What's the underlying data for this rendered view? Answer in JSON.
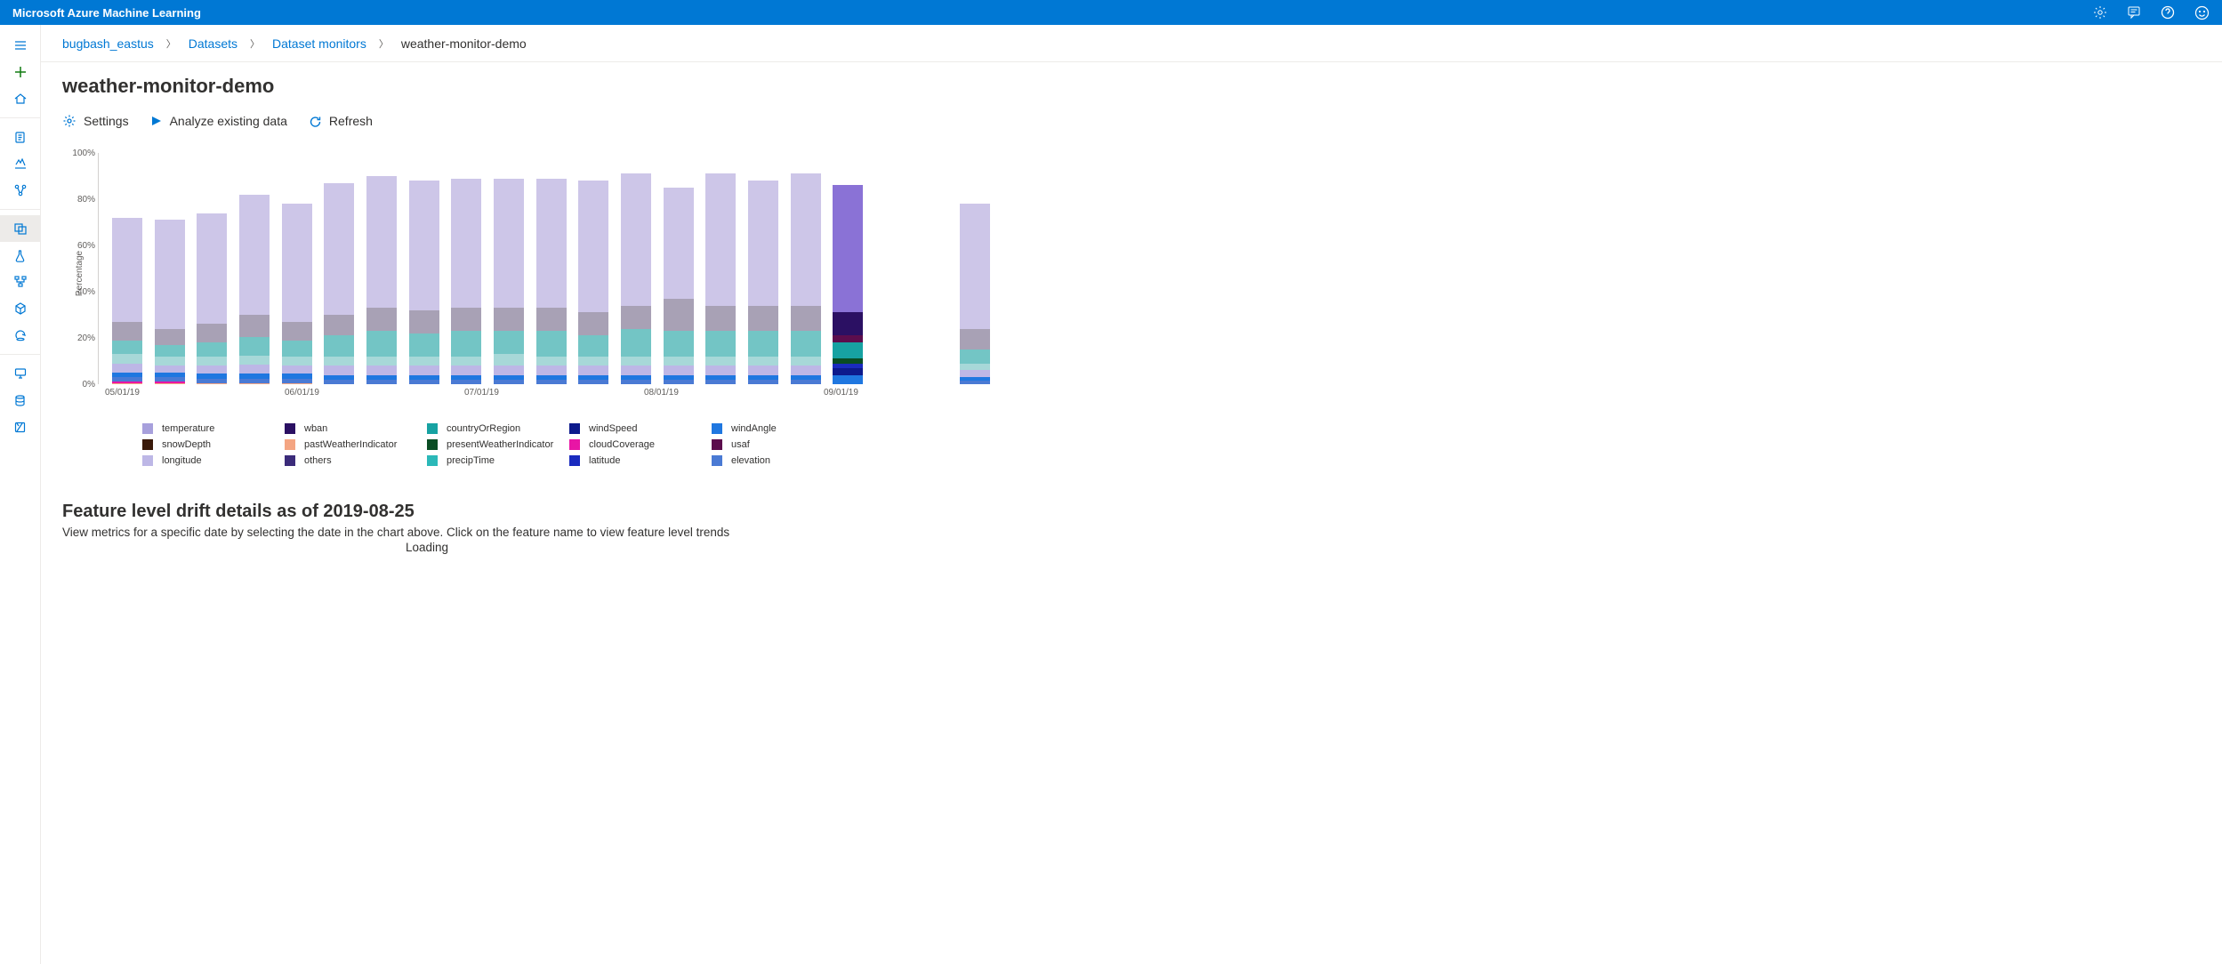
{
  "app_title": "Microsoft Azure Machine Learning",
  "breadcrumb": {
    "items": [
      "bugbash_eastus",
      "Datasets",
      "Dataset monitors"
    ],
    "current": "weather-monitor-demo"
  },
  "page_title": "weather-monitor-demo",
  "toolbar": {
    "settings": "Settings",
    "analyze": "Analyze existing data",
    "refresh": "Refresh"
  },
  "section": {
    "heading": "Feature level drift details as of 2019-08-25",
    "sub": "View metrics for a specific date by selecting the date in the chart above. Click on the feature name to view feature level trends",
    "loading": "Loading"
  },
  "chart_data": {
    "type": "bar",
    "ylabel": "Percentage",
    "ylim": [
      0,
      100
    ],
    "yticks": [
      0,
      20,
      40,
      60,
      80,
      100
    ],
    "xtick_labels": [
      {
        "x": 0,
        "label": "05/01/19"
      },
      {
        "x": 4,
        "label": "06/01/19"
      },
      {
        "x": 8,
        "label": "07/01/19"
      },
      {
        "x": 12,
        "label": "08/01/19"
      },
      {
        "x": 16,
        "label": "09/01/19"
      }
    ],
    "series": [
      {
        "name": "temperature",
        "color": "#a7a0dc"
      },
      {
        "name": "wban",
        "color": "#2b1063"
      },
      {
        "name": "countryOrRegion",
        "color": "#17a2a2"
      },
      {
        "name": "windSpeed",
        "color": "#0d1a8c"
      },
      {
        "name": "windAngle",
        "color": "#1f77e0"
      },
      {
        "name": "snowDepth",
        "color": "#3a1a0a"
      },
      {
        "name": "pastWeatherIndicator",
        "color": "#f4a582"
      },
      {
        "name": "presentWeatherIndicator",
        "color": "#0a4d24"
      },
      {
        "name": "cloudCoverage",
        "color": "#e815a5"
      },
      {
        "name": "usaf",
        "color": "#5c0d4d"
      },
      {
        "name": "longitude",
        "color": "#bdb7e6"
      },
      {
        "name": "others",
        "color": "#3b2b7a"
      },
      {
        "name": "precipTime",
        "color": "#2bb8b8"
      },
      {
        "name": "latitude",
        "color": "#1a2bbf"
      },
      {
        "name": "elevation",
        "color": "#4a7ad4"
      }
    ],
    "bars": [
      {
        "total": 72,
        "segs": [
          {
            "c": "#f4a582",
            "v": 0.5
          },
          {
            "c": "#e815a5",
            "v": 0.5
          },
          {
            "c": "#4a7ad4",
            "v": 2
          },
          {
            "c": "#1f77e0",
            "v": 2
          },
          {
            "c": "#bdb7e6",
            "v": 4
          },
          {
            "c": "#a7d8d8",
            "v": 4
          },
          {
            "c": "#73c5c5",
            "v": 6
          },
          {
            "c": "#a8a1b5",
            "v": 8
          },
          {
            "c": "#cdc6e8",
            "v": 45
          }
        ]
      },
      {
        "total": 71,
        "segs": [
          {
            "c": "#f4a582",
            "v": 0.5
          },
          {
            "c": "#e815a5",
            "v": 0.5
          },
          {
            "c": "#4a7ad4",
            "v": 2
          },
          {
            "c": "#1f77e0",
            "v": 2
          },
          {
            "c": "#bdb7e6",
            "v": 3
          },
          {
            "c": "#a7d8d8",
            "v": 4
          },
          {
            "c": "#73c5c5",
            "v": 5
          },
          {
            "c": "#a8a1b5",
            "v": 7
          },
          {
            "c": "#cdc6e8",
            "v": 47
          }
        ]
      },
      {
        "total": 74,
        "segs": [
          {
            "c": "#f4a582",
            "v": 0.5
          },
          {
            "c": "#4a7ad4",
            "v": 2
          },
          {
            "c": "#1f77e0",
            "v": 2
          },
          {
            "c": "#bdb7e6",
            "v": 3.5
          },
          {
            "c": "#a7d8d8",
            "v": 4
          },
          {
            "c": "#73c5c5",
            "v": 6
          },
          {
            "c": "#a8a1b5",
            "v": 8
          },
          {
            "c": "#cdc6e8",
            "v": 48
          }
        ]
      },
      {
        "total": 82,
        "segs": [
          {
            "c": "#f4a582",
            "v": 0.5
          },
          {
            "c": "#4a7ad4",
            "v": 2
          },
          {
            "c": "#1f77e0",
            "v": 2
          },
          {
            "c": "#bdb7e6",
            "v": 4
          },
          {
            "c": "#a7d8d8",
            "v": 4
          },
          {
            "c": "#73c5c5",
            "v": 8
          },
          {
            "c": "#a8a1b5",
            "v": 9.5
          },
          {
            "c": "#cdc6e8",
            "v": 52
          }
        ]
      },
      {
        "total": 78,
        "segs": [
          {
            "c": "#f4a582",
            "v": 0.5
          },
          {
            "c": "#4a7ad4",
            "v": 2
          },
          {
            "c": "#1f77e0",
            "v": 2
          },
          {
            "c": "#bdb7e6",
            "v": 3.5
          },
          {
            "c": "#a7d8d8",
            "v": 4
          },
          {
            "c": "#73c5c5",
            "v": 7
          },
          {
            "c": "#a8a1b5",
            "v": 8
          },
          {
            "c": "#cdc6e8",
            "v": 51
          }
        ]
      },
      {
        "total": 87,
        "segs": [
          {
            "c": "#4a7ad4",
            "v": 2
          },
          {
            "c": "#1f77e0",
            "v": 2
          },
          {
            "c": "#bdb7e6",
            "v": 4
          },
          {
            "c": "#a7d8d8",
            "v": 4
          },
          {
            "c": "#73c5c5",
            "v": 9
          },
          {
            "c": "#a8a1b5",
            "v": 9
          },
          {
            "c": "#cdc6e8",
            "v": 57
          }
        ]
      },
      {
        "total": 90,
        "segs": [
          {
            "c": "#4a7ad4",
            "v": 2
          },
          {
            "c": "#1f77e0",
            "v": 2
          },
          {
            "c": "#bdb7e6",
            "v": 4
          },
          {
            "c": "#a7d8d8",
            "v": 4
          },
          {
            "c": "#73c5c5",
            "v": 11
          },
          {
            "c": "#a8a1b5",
            "v": 10
          },
          {
            "c": "#cdc6e8",
            "v": 57
          }
        ]
      },
      {
        "total": 88,
        "segs": [
          {
            "c": "#4a7ad4",
            "v": 2
          },
          {
            "c": "#1f77e0",
            "v": 2
          },
          {
            "c": "#bdb7e6",
            "v": 4
          },
          {
            "c": "#a7d8d8",
            "v": 4
          },
          {
            "c": "#73c5c5",
            "v": 10
          },
          {
            "c": "#a8a1b5",
            "v": 10
          },
          {
            "c": "#cdc6e8",
            "v": 56
          }
        ]
      },
      {
        "total": 89,
        "segs": [
          {
            "c": "#4a7ad4",
            "v": 2
          },
          {
            "c": "#1f77e0",
            "v": 2
          },
          {
            "c": "#bdb7e6",
            "v": 4
          },
          {
            "c": "#a7d8d8",
            "v": 4
          },
          {
            "c": "#73c5c5",
            "v": 11
          },
          {
            "c": "#a8a1b5",
            "v": 10
          },
          {
            "c": "#cdc6e8",
            "v": 56
          }
        ]
      },
      {
        "total": 89,
        "segs": [
          {
            "c": "#4a7ad4",
            "v": 2
          },
          {
            "c": "#1f77e0",
            "v": 2
          },
          {
            "c": "#bdb7e6",
            "v": 4
          },
          {
            "c": "#a7d8d8",
            "v": 5
          },
          {
            "c": "#73c5c5",
            "v": 10
          },
          {
            "c": "#a8a1b5",
            "v": 10
          },
          {
            "c": "#cdc6e8",
            "v": 56
          }
        ]
      },
      {
        "total": 89,
        "segs": [
          {
            "c": "#4a7ad4",
            "v": 2
          },
          {
            "c": "#1f77e0",
            "v": 2
          },
          {
            "c": "#bdb7e6",
            "v": 4
          },
          {
            "c": "#a7d8d8",
            "v": 4
          },
          {
            "c": "#73c5c5",
            "v": 11
          },
          {
            "c": "#a8a1b5",
            "v": 10
          },
          {
            "c": "#cdc6e8",
            "v": 56
          }
        ]
      },
      {
        "total": 88,
        "segs": [
          {
            "c": "#4a7ad4",
            "v": 2
          },
          {
            "c": "#1f77e0",
            "v": 2
          },
          {
            "c": "#bdb7e6",
            "v": 4
          },
          {
            "c": "#a7d8d8",
            "v": 4
          },
          {
            "c": "#73c5c5",
            "v": 9
          },
          {
            "c": "#a8a1b5",
            "v": 10
          },
          {
            "c": "#cdc6e8",
            "v": 57
          }
        ]
      },
      {
        "total": 91,
        "segs": [
          {
            "c": "#4a7ad4",
            "v": 2
          },
          {
            "c": "#1f77e0",
            "v": 2
          },
          {
            "c": "#bdb7e6",
            "v": 4
          },
          {
            "c": "#a7d8d8",
            "v": 4
          },
          {
            "c": "#73c5c5",
            "v": 12
          },
          {
            "c": "#a8a1b5",
            "v": 10
          },
          {
            "c": "#cdc6e8",
            "v": 57
          }
        ]
      },
      {
        "total": 85,
        "segs": [
          {
            "c": "#4a7ad4",
            "v": 2
          },
          {
            "c": "#1f77e0",
            "v": 2
          },
          {
            "c": "#bdb7e6",
            "v": 4
          },
          {
            "c": "#a7d8d8",
            "v": 4
          },
          {
            "c": "#73c5c5",
            "v": 11
          },
          {
            "c": "#a8a1b5",
            "v": 14
          },
          {
            "c": "#cdc6e8",
            "v": 48
          }
        ]
      },
      {
        "total": 91,
        "segs": [
          {
            "c": "#4a7ad4",
            "v": 2
          },
          {
            "c": "#1f77e0",
            "v": 2
          },
          {
            "c": "#bdb7e6",
            "v": 4
          },
          {
            "c": "#a7d8d8",
            "v": 4
          },
          {
            "c": "#73c5c5",
            "v": 11
          },
          {
            "c": "#a8a1b5",
            "v": 11
          },
          {
            "c": "#cdc6e8",
            "v": 57
          }
        ]
      },
      {
        "total": 88,
        "segs": [
          {
            "c": "#4a7ad4",
            "v": 2
          },
          {
            "c": "#1f77e0",
            "v": 2
          },
          {
            "c": "#bdb7e6",
            "v": 4
          },
          {
            "c": "#a7d8d8",
            "v": 4
          },
          {
            "c": "#73c5c5",
            "v": 11
          },
          {
            "c": "#a8a1b5",
            "v": 11
          },
          {
            "c": "#cdc6e8",
            "v": 54
          }
        ]
      },
      {
        "total": 91,
        "segs": [
          {
            "c": "#4a7ad4",
            "v": 2
          },
          {
            "c": "#1f77e0",
            "v": 2
          },
          {
            "c": "#bdb7e6",
            "v": 4
          },
          {
            "c": "#a7d8d8",
            "v": 4
          },
          {
            "c": "#73c5c5",
            "v": 11
          },
          {
            "c": "#a8a1b5",
            "v": 11
          },
          {
            "c": "#cdc6e8",
            "v": 57
          }
        ]
      },
      {
        "total": 86,
        "segs": [
          {
            "c": "#1f77e0",
            "v": 4
          },
          {
            "c": "#0d1a8c",
            "v": 3
          },
          {
            "c": "#1a2bbf",
            "v": 2
          },
          {
            "c": "#0a4d24",
            "v": 2
          },
          {
            "c": "#17a2a2",
            "v": 7
          },
          {
            "c": "#5c0d4d",
            "v": 3
          },
          {
            "c": "#2b1063",
            "v": 10
          },
          {
            "c": "#8a72d6",
            "v": 55
          }
        ]
      },
      {
        "total": 0,
        "segs": []
      },
      {
        "total": 0,
        "segs": []
      },
      {
        "total": 78,
        "segs": [
          {
            "c": "#4a7ad4",
            "v": 1.5
          },
          {
            "c": "#1f77e0",
            "v": 1.5
          },
          {
            "c": "#bdb7e6",
            "v": 3
          },
          {
            "c": "#a7d8d8",
            "v": 3
          },
          {
            "c": "#73c5c5",
            "v": 6
          },
          {
            "c": "#a8a1b5",
            "v": 9
          },
          {
            "c": "#cdc6e8",
            "v": 54
          }
        ]
      }
    ]
  }
}
